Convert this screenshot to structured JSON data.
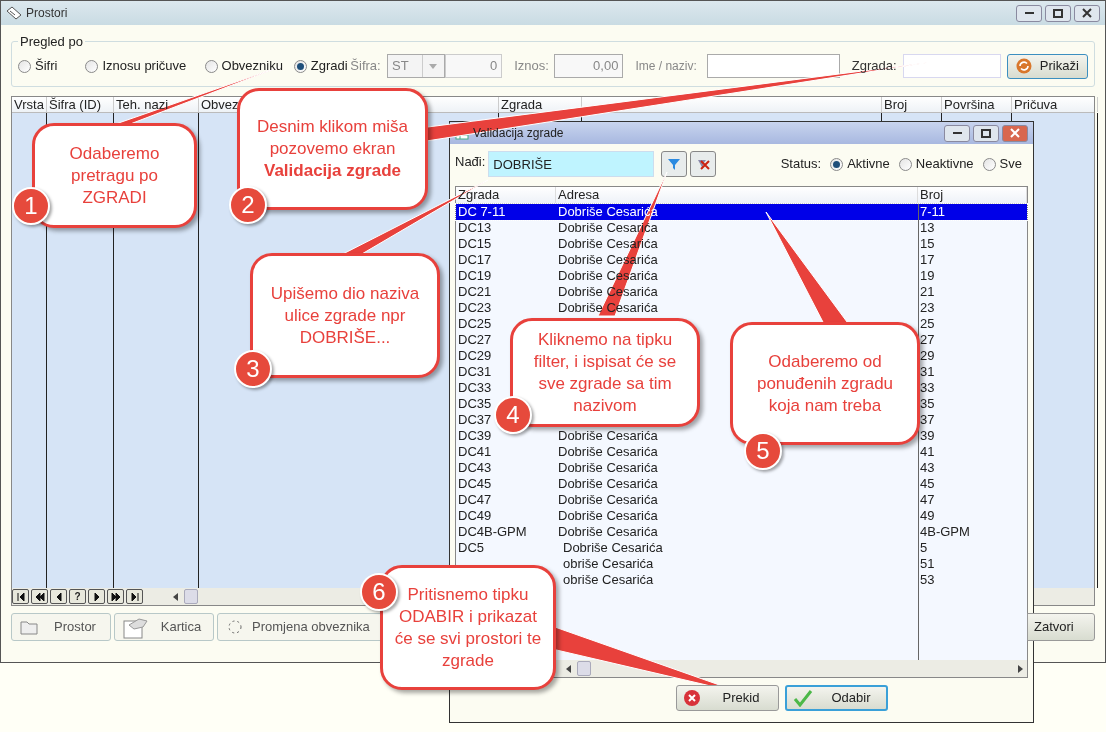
{
  "window": {
    "title": "Prostori"
  },
  "filter": {
    "legend": "Pregled po",
    "radios": [
      {
        "label": "Šifri",
        "selected": false
      },
      {
        "label": "Iznosu pričuve",
        "selected": false
      },
      {
        "label": "Obvezniku",
        "selected": false
      },
      {
        "label": "Zgradi",
        "selected": true
      }
    ],
    "sifra_label": "Šifra:",
    "sifra_value": "ST",
    "sifra_number": "0",
    "iznos_label": "Iznos:",
    "iznos_value": "0,00",
    "ime_label": "Ime / naziv:",
    "zgrada_label": "Zgrada:",
    "show_button": "Prikaži"
  },
  "grid": {
    "columns": [
      "Vrsta",
      "Šifra (ID)",
      "Teh. nazi",
      "Obvez",
      "Zgrada",
      "Broj",
      "Površina",
      "Pričuva"
    ],
    "nav_help": "?"
  },
  "bottom_buttons": [
    "Prostor",
    "Kartica",
    "Promjena obveznika"
  ],
  "close_button": "Zatvori",
  "dialog": {
    "title": "Validacija zgrade",
    "search_label": "Nađi:",
    "search_value": "DOBRIŠE",
    "status_label": "Status:",
    "status": [
      {
        "label": "Aktivne",
        "selected": true
      },
      {
        "label": "Neaktivne",
        "selected": false
      },
      {
        "label": "Sve",
        "selected": false
      }
    ],
    "columns": [
      "Zgrada",
      "Adresa",
      "Broj"
    ],
    "rows": [
      {
        "zgrada": "DC 7-11",
        "adresa": "Dobriše Cesarića",
        "broj": "7-11",
        "selected": true
      },
      {
        "zgrada": "DC13",
        "adresa": "Dobriše Cesarića",
        "broj": "13",
        "selected": false
      },
      {
        "zgrada": "DC15",
        "adresa": "Dobriše Cesarića",
        "broj": "15",
        "selected": false
      },
      {
        "zgrada": "DC17",
        "adresa": "Dobriše Cesarića",
        "broj": "17",
        "selected": false
      },
      {
        "zgrada": "DC19",
        "adresa": "Dobriše Cesarića",
        "broj": "19",
        "selected": false
      },
      {
        "zgrada": "DC21",
        "adresa": "Dobriše Cesarića",
        "broj": "21",
        "selected": false
      },
      {
        "zgrada": "DC23",
        "adresa": "Dobriše Cesarića",
        "broj": "23",
        "selected": false
      },
      {
        "zgrada": "DC25",
        "broj": "25",
        "selected": false
      },
      {
        "zgrada": "DC27",
        "broj": "27",
        "selected": false
      },
      {
        "zgrada": "DC29",
        "broj": "29",
        "selected": false
      },
      {
        "zgrada": "DC31",
        "broj": "31",
        "selected": false
      },
      {
        "zgrada": "DC33",
        "broj": "33",
        "selected": false
      },
      {
        "zgrada": "DC35",
        "broj": "35",
        "selected": false
      },
      {
        "zgrada": "DC37",
        "broj": "37",
        "selected": false
      },
      {
        "zgrada": "DC39",
        "adresa": "Dobriše Cesarića",
        "broj": "39",
        "selected": false
      },
      {
        "zgrada": "DC41",
        "adresa": "Dobriše Cesarića",
        "broj": "41",
        "selected": false
      },
      {
        "zgrada": "DC43",
        "adresa": "Dobriše Cesarića",
        "broj": "43",
        "selected": false
      },
      {
        "zgrada": "DC45",
        "adresa": "Dobriše Cesarića",
        "broj": "45",
        "selected": false
      },
      {
        "zgrada": "DC47",
        "adresa": "Dobriše Cesarića",
        "broj": "47",
        "selected": false
      },
      {
        "zgrada": "DC49",
        "adresa": "Dobriše Cesarića",
        "broj": "49",
        "selected": false
      },
      {
        "zgrada": "DC4B-GPM",
        "adresa": "Dobriše Cesarića",
        "broj": "4B-GPM",
        "selected": false
      },
      {
        "zgrada": "DC5",
        "adresa": "Dobriše Cesarića",
        "broj": "5",
        "selected": false
      },
      {
        "adresa": "obriše Cesarića",
        "broj": "51",
        "selected": false
      },
      {
        "adresa": "obriše Cesarića",
        "broj": "53",
        "selected": false
      }
    ],
    "buttons": [
      {
        "label": "Prekid",
        "kind": "cancel",
        "focused": false
      },
      {
        "label": "Odabir",
        "kind": "ok",
        "focused": true
      }
    ]
  },
  "callouts": [
    {
      "number": "1",
      "text": "Odaberemo pretragu po ZGRADI"
    },
    {
      "number": "2",
      "text": "Desnim klikom miša pozovemo ekran **Validacija zgrade**"
    },
    {
      "number": "3",
      "text": "Upišemo dio naziva ulice zgrade npr DOBRIŠE..."
    },
    {
      "number": "4",
      "text": "Kliknemo na tipku filter, i ispisat će se sve zgrade sa tim nazivom"
    },
    {
      "number": "5",
      "text": "Odaberemo od ponuđenih zgradu koja nam treba"
    },
    {
      "number": "6",
      "text": "Pritisnemo tipku ODABIR i prikazat će se svi prostori te zgrade"
    }
  ]
}
